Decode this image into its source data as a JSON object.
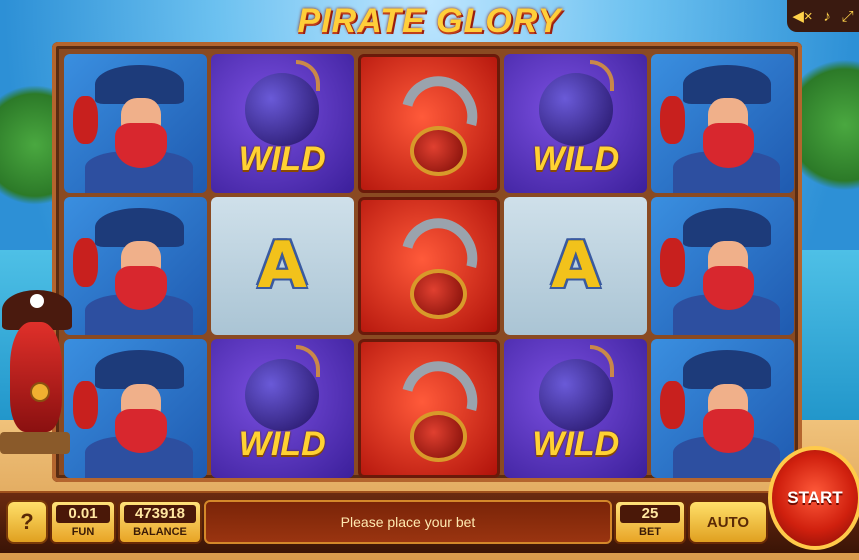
{
  "game": {
    "title": "PIRATE GLORY"
  },
  "top_controls": {
    "icons": [
      "mute-icon",
      "music-icon",
      "fullscreen-icon"
    ],
    "glyphs": [
      "◀×",
      "♪",
      "⤢"
    ]
  },
  "reels": {
    "grid": [
      [
        "pirate",
        "wild",
        "hook",
        "wild",
        "pirate"
      ],
      [
        "pirate",
        "A",
        "hook",
        "A",
        "pirate"
      ],
      [
        "pirate",
        "wild",
        "hook",
        "wild",
        "pirate"
      ]
    ],
    "wild_text": "WILD",
    "letter": "A"
  },
  "bottom_bar": {
    "help_label": "?",
    "coin": {
      "value": "0.01",
      "label": "FUN"
    },
    "balance": {
      "value": "473918",
      "label": "BALANCE"
    },
    "message": "Please place your bet",
    "bet": {
      "value": "25",
      "label": "BET"
    },
    "auto_label": "AUTO",
    "start_label": "START"
  },
  "colors": {
    "accent": "#ffcf3a",
    "frame": "#8a4a22",
    "start": "#d0200e"
  }
}
